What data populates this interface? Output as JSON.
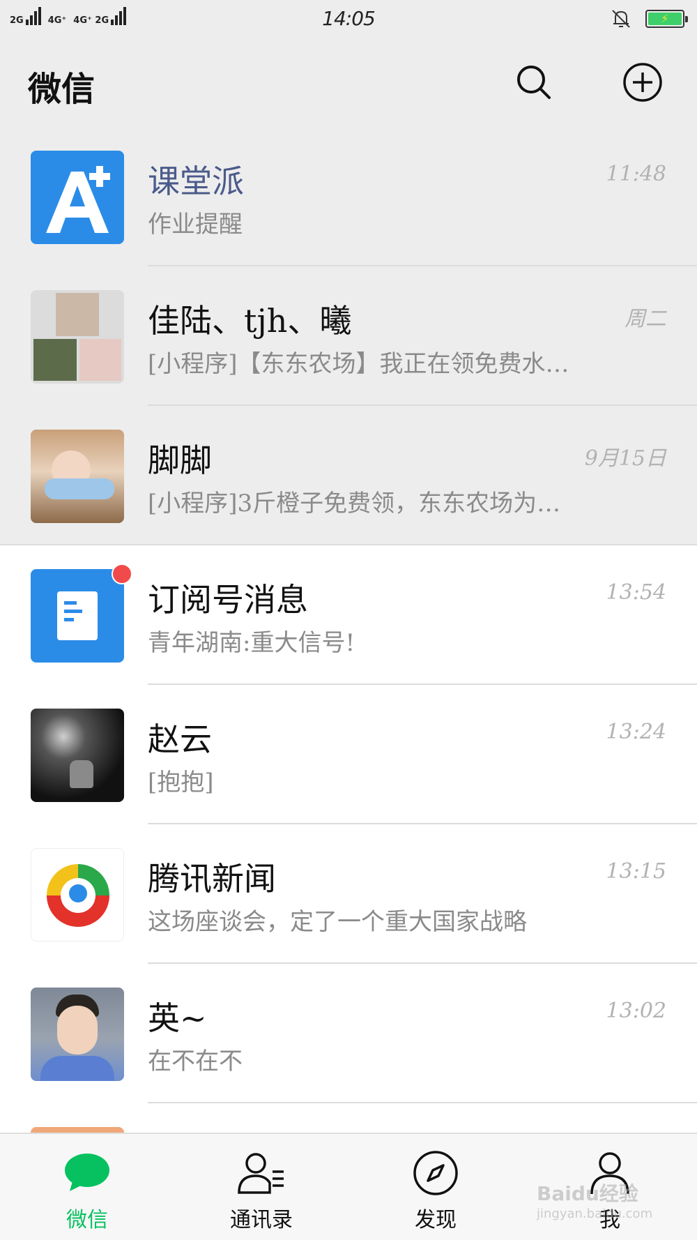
{
  "status_bar": {
    "network_1": "2G",
    "network_2": "4G⁺",
    "network_3": "4G⁺ 2G",
    "time": "14:05",
    "battery_color": "#3ecf6a"
  },
  "header": {
    "title": "微信",
    "search_icon": "search-icon",
    "add_icon": "plus-circle-icon"
  },
  "chats": [
    {
      "name": "课堂派",
      "preview": "作业提醒",
      "time": "11:48",
      "pinned": true,
      "avatar_icon": "ketangpai-logo"
    },
    {
      "name": "佳陆、tjh、曦",
      "preview": "[小程序]【东东农场】我正在领免费水…",
      "time": "周二",
      "pinned": true,
      "avatar_icon": "group-photo-avatar"
    },
    {
      "name": "脚脚",
      "preview": "[小程序]3斤橙子免费领，东东农场为…",
      "time": "9月15日",
      "pinned": true,
      "avatar_icon": "photo-avatar"
    },
    {
      "name": "订阅号消息",
      "preview": "青年湖南:重大信号!",
      "time": "13:54",
      "pinned": false,
      "avatar_icon": "subscription-icon",
      "unread": true
    },
    {
      "name": "赵云",
      "preview": "[抱抱]",
      "time": "13:24",
      "pinned": false,
      "avatar_icon": "photo-avatar"
    },
    {
      "name": "腾讯新闻",
      "preview": "这场座谈会，定了一个重大国家战略",
      "time": "13:15",
      "pinned": false,
      "avatar_icon": "tencent-news-logo"
    },
    {
      "name": "英~",
      "preview": "在不在不",
      "time": "13:02",
      "pinned": false,
      "avatar_icon": "photo-avatar"
    }
  ],
  "tabs": [
    {
      "label": "微信",
      "icon": "chat-bubble-icon",
      "active": true
    },
    {
      "label": "通讯录",
      "icon": "contacts-icon",
      "active": false
    },
    {
      "label": "发现",
      "icon": "compass-icon",
      "active": false
    },
    {
      "label": "我",
      "icon": "person-icon",
      "active": false
    }
  ],
  "watermark": {
    "text": "Baidu经验",
    "sub": "jingyan.baidu.com"
  },
  "colors": {
    "accent": "#07c160",
    "header_bg": "#ededed",
    "unread": "#f24a4a"
  }
}
